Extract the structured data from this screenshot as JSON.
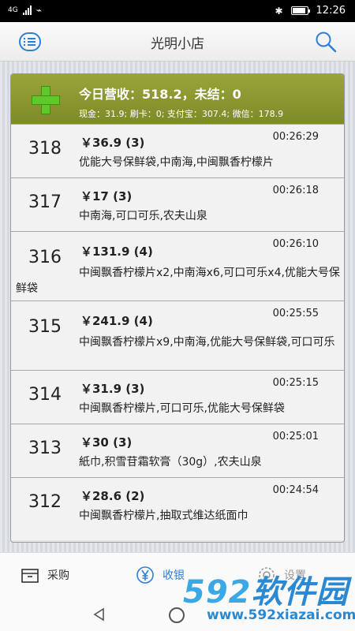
{
  "status_bar": {
    "network": "4G",
    "time": "12:26"
  },
  "header": {
    "title": "光明小店"
  },
  "summary": {
    "title": "今日营收：518.2，未结：0",
    "detail": "现金：31.9; 刷卡：0; 支付宝：307.4; 微信：178.9"
  },
  "orders": [
    {
      "number": "318",
      "amount": "￥36.9 (3)",
      "time": "00:26:29",
      "items": "优能大号保鲜袋,中南海,中闽飘香柠檬片"
    },
    {
      "number": "317",
      "amount": "￥17 (3)",
      "time": "00:26:18",
      "items": "中南海,可口可乐,农夫山泉"
    },
    {
      "number": "316",
      "amount": "￥131.9 (4)",
      "time": "00:26:10",
      "items": "中闽飘香柠檬片x2,中南海x6,可口可乐x4,优能大号保鲜袋"
    },
    {
      "number": "315",
      "amount": "￥241.9 (4)",
      "time": "00:25:55",
      "items": "中闽飘香柠檬片x9,中南海,优能大号保鲜袋,可口可乐"
    },
    {
      "number": "314",
      "amount": "￥31.9 (3)",
      "time": "00:25:15",
      "items": "中闽飘香柠檬片,可口可乐,优能大号保鲜袋"
    },
    {
      "number": "313",
      "amount": "￥30 (3)",
      "time": "00:25:01",
      "items": "紙巾,积雪苷霜软膏（30g）,农夫山泉"
    },
    {
      "number": "312",
      "amount": "￥28.6 (2)",
      "time": "00:24:54",
      "items": "中闽飘香柠檬片,抽取式维达纸面巾"
    }
  ],
  "bottom_nav": {
    "purchase": "采购",
    "cashier": "收银",
    "settings": "设置"
  },
  "watermark": {
    "logo_num": "592",
    "logo_cn": "软件园",
    "url": "www.592xiazai.com"
  },
  "colors": {
    "accent": "#2e7fd4",
    "summary_bg": "#8e9830",
    "plus": "#5fc92a"
  },
  "icons": [
    "menu-icon",
    "search-icon",
    "plus-icon",
    "box-icon",
    "yen-icon",
    "gear-icon",
    "back-icon",
    "home-icon"
  ]
}
